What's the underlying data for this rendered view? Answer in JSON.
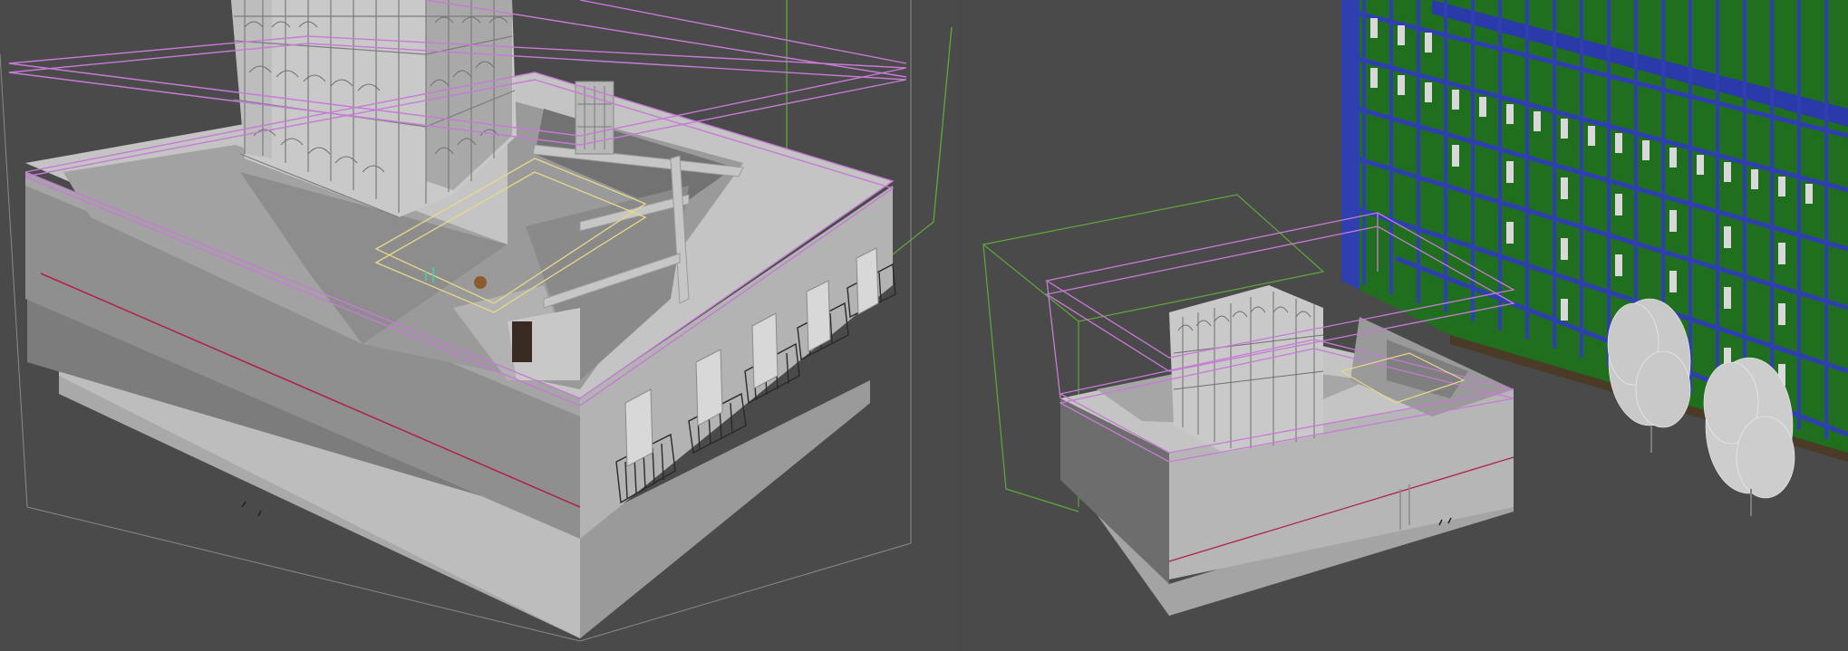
{
  "colors": {
    "background": "#4a4a4a",
    "wall_light": "#b9b9b9",
    "wall_mid": "#9c9c9c",
    "wall_dark": "#6f6f6f",
    "floor": "#a8a8a8",
    "selection_magenta": "#c77ad6",
    "bounding_green": "#5fa83a",
    "highlight_yellow": "#e6d98a",
    "facade_green": "#1e7a1e",
    "facade_blue": "#2f3fb0",
    "red_line": "#b0204a"
  },
  "viewports": [
    {
      "name": "perspective-left",
      "content": "building-model-closeup"
    },
    {
      "name": "perspective-right",
      "content": "building-model-with-facade-and-trees"
    }
  ]
}
